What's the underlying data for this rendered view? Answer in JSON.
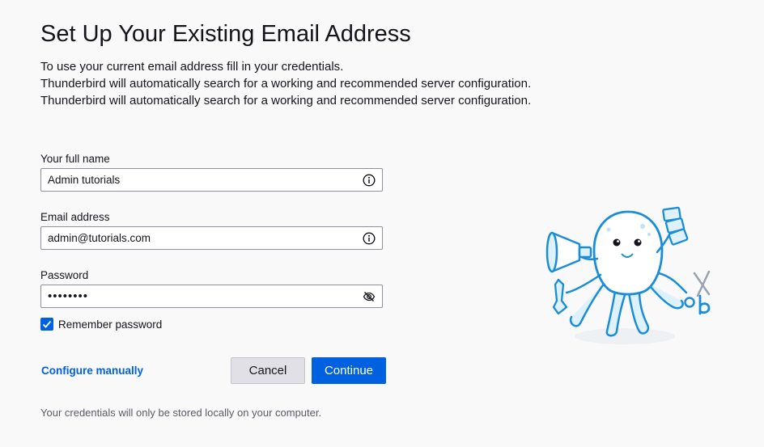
{
  "page": {
    "title": "Set Up Your Existing Email Address",
    "intro_lines": [
      "To use your current email address fill in your credentials.",
      "Thunderbird will automatically search for a working and recommended server configuration.",
      "Thunderbird will automatically search for a working and recommended server configuration."
    ]
  },
  "form": {
    "full_name": {
      "label": "Your full name",
      "value": "Admin tutorials",
      "icon": "info-icon"
    },
    "email": {
      "label": "Email address",
      "value": "admin@tutorials.com",
      "icon": "info-icon"
    },
    "password": {
      "label": "Password",
      "value": "••••••••",
      "icon": "eye-slash-icon"
    },
    "remember_password": {
      "label": "Remember password",
      "checked": true
    }
  },
  "actions": {
    "configure_manually": "Configure manually",
    "cancel": "Cancel",
    "continue": "Continue"
  },
  "footer": {
    "note": "Your credentials will only be stored locally on your computer."
  },
  "colors": {
    "accent": "#0061e0",
    "background": "#f9f9fa",
    "text": "#15141a",
    "muted_text": "#5b5b66",
    "mascot_outline": "#1a8dd9",
    "mascot_fill": "#dff1fc"
  }
}
